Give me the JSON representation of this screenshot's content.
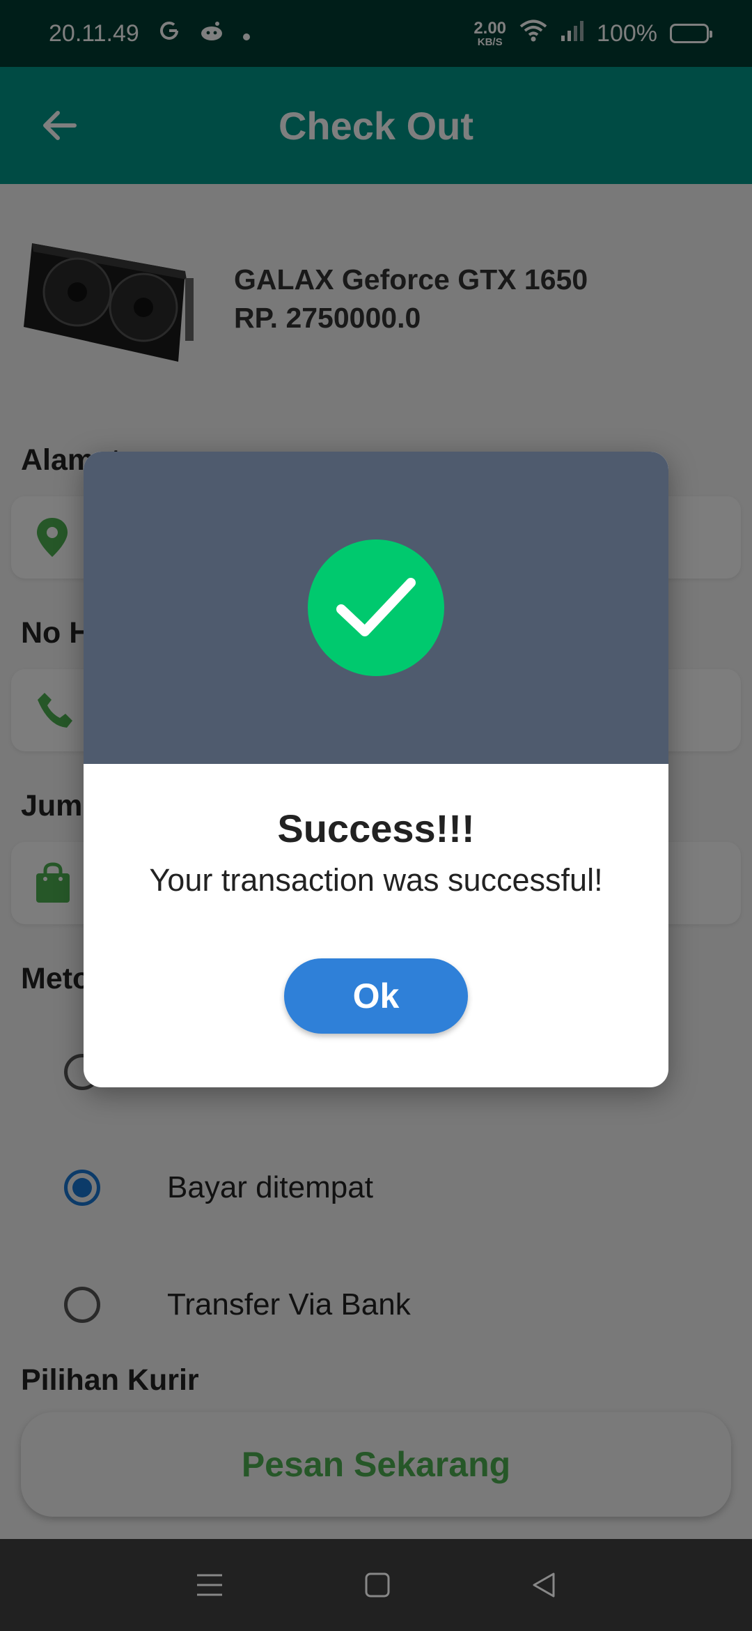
{
  "status_bar": {
    "time": "20.11.49",
    "net_speed_value": "2.00",
    "net_speed_unit": "KB/S",
    "battery": "100%"
  },
  "app_bar": {
    "title": "Check Out"
  },
  "product": {
    "name": "GALAX Geforce GTX 1650",
    "price": "RP. 2750000.0"
  },
  "form": {
    "address_label": "Alamat",
    "phone_label": "No HP",
    "quantity_label": "Jumlah",
    "payment_label": "Metode Pembayaran",
    "payment_options": [
      {
        "label": "Bayar ditempat",
        "selected": true
      },
      {
        "label": "Transfer Via Bank",
        "selected": false
      }
    ],
    "courier_label": "Pilihan Kurir"
  },
  "order_button": "Pesan Sekarang",
  "dialog": {
    "title": "Success!!!",
    "message": "Your transaction was successful!",
    "ok_label": "Ok",
    "header_color": "#4f5b6e",
    "success_color": "#00c96e",
    "button_color": "#2f80d8"
  },
  "colors": {
    "status_bar": "#003d33",
    "app_bar": "#009688",
    "accent_green": "#4caf50",
    "radio_blue": "#1976d2"
  },
  "icons": {
    "back": "arrow-left-icon",
    "location": "location-pin-icon",
    "phone": "phone-icon",
    "bag": "shopping-bag-icon",
    "success": "check-icon"
  }
}
